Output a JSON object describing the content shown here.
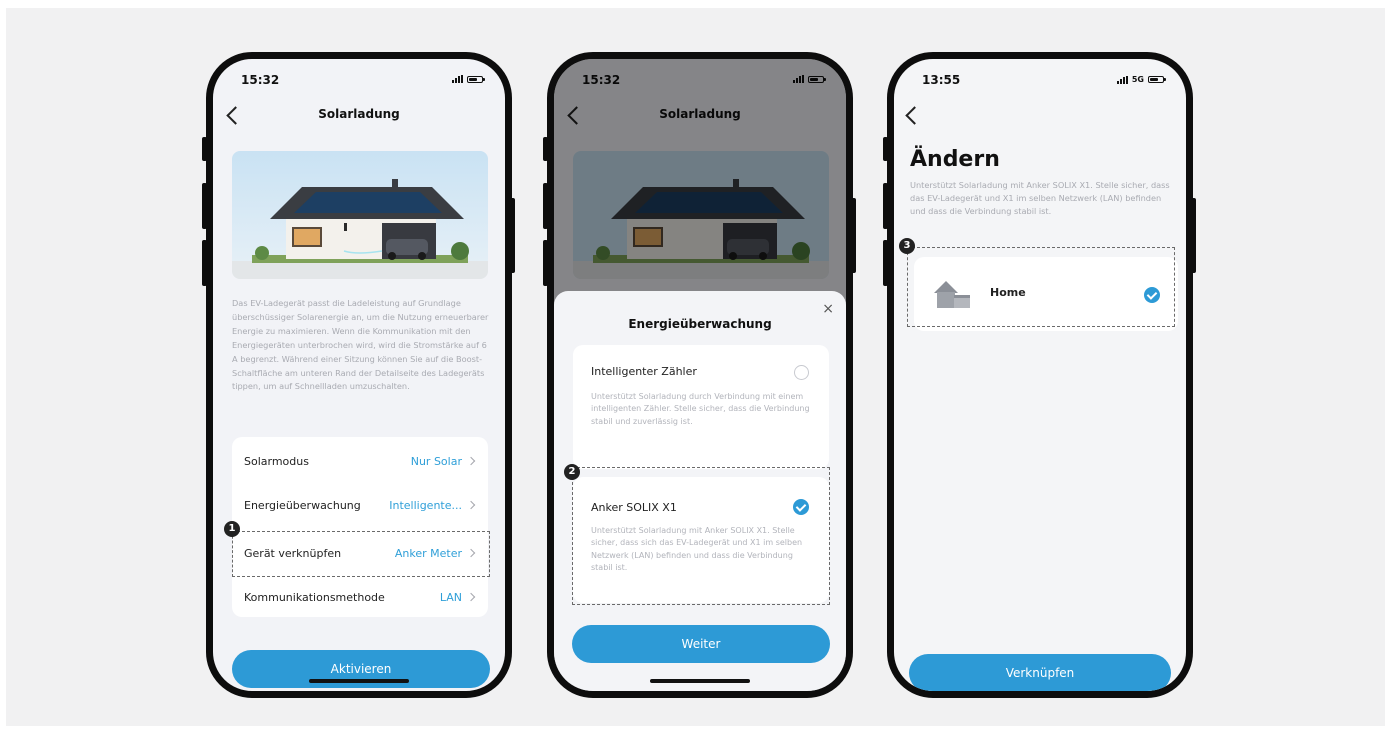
{
  "screen1": {
    "time": "15:32",
    "title": "Solarladung",
    "description": "Das EV-Ladegerät passt die Ladeleistung auf Grundlage überschüssiger Solarenergie an, um die Nutzung erneuerbarer Energie zu maximieren. Wenn die Kommunikation mit den Energiegeräten unterbrochen wird, wird die Stromstärke auf 6 A begrenzt. Während einer Sitzung können Sie auf die Boost-Schaltfläche am unteren Rand der Detailseite des Ladegeräts tippen, um auf Schnellladen umzuschalten.",
    "settings": [
      {
        "label": "Solarmodus",
        "value": "Nur Solar"
      },
      {
        "label": "Energieüberwachung",
        "value": "Intelligente..."
      },
      {
        "label": "Gerät verknüpfen",
        "value": "Anker Meter"
      },
      {
        "label": "Kommunikationsmethode",
        "value": "LAN"
      }
    ],
    "badge": "1",
    "button": "Aktivieren"
  },
  "screen2": {
    "time": "15:32",
    "title": "Solarladung",
    "sheet_title": "Energieüberwachung",
    "close": "×",
    "options": [
      {
        "title": "Intelligenter Zähler",
        "desc": "Unterstützt Solarladung durch Verbindung mit einem intelligenten Zähler. Stelle sicher, dass die Verbindung stabil und zuverlässig ist.",
        "selected": false
      },
      {
        "title": "Anker SOLIX X1",
        "desc": "Unterstützt Solarladung mit Anker SOLIX X1. Stelle sicher, dass sich das EV-Ladegerät und X1 im selben Netzwerk (LAN) befinden und dass die Verbindung stabil ist.",
        "selected": true
      }
    ],
    "badge": "2",
    "button": "Weiter"
  },
  "screen3": {
    "time": "13:55",
    "network": "5G",
    "title": "Ändern",
    "description": "Unterstützt Solarladung mit Anker SOLIX X1. Stelle sicher, dass das EV-Ladegerät und X1 im selben Netzwerk (LAN) befinden und dass die Verbindung stabil ist.",
    "home_label": "Home",
    "badge": "3",
    "button": "Verknüpfen"
  },
  "colors": {
    "accent": "#2d9ad6",
    "background": "#f1f1f2"
  }
}
